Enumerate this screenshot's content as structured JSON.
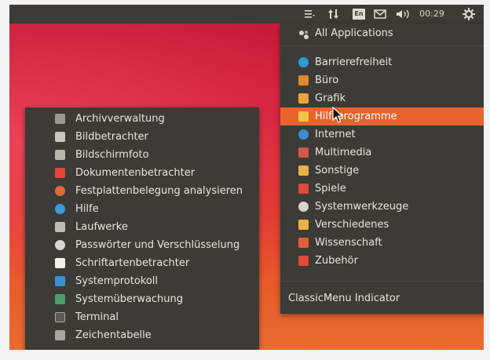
{
  "topbar": {
    "menu_icon": "menu-indicator-icon",
    "network_icon": "network-updown-icon",
    "keyboard_layout": "En",
    "mail_icon": "mail-icon",
    "volume_icon": "volume-icon",
    "clock": "00:29",
    "settings_icon": "gear-icon"
  },
  "main_menu": {
    "all_apps": "All Applications",
    "categories": [
      {
        "label": "Barrierefreiheit",
        "icon": "accessibility-icon",
        "color": "#2f98d8"
      },
      {
        "label": "Büro",
        "icon": "office-icon",
        "color": "#e0892e"
      },
      {
        "label": "Grafik",
        "icon": "graphics-icon",
        "color": "#f0a33a"
      },
      {
        "label": "Hilfsprogramme",
        "icon": "utilities-icon",
        "color": "#f2a53a",
        "active": true
      },
      {
        "label": "Internet",
        "icon": "internet-icon",
        "color": "#3b8ed6"
      },
      {
        "label": "Multimedia",
        "icon": "multimedia-icon",
        "color": "#d2584a"
      },
      {
        "label": "Sonstige",
        "icon": "other-icon",
        "color": "#e8b543"
      },
      {
        "label": "Spiele",
        "icon": "games-icon",
        "color": "#e04a3c"
      },
      {
        "label": "Systemwerkzeuge",
        "icon": "system-tools-icon",
        "color": "#d8d4cc"
      },
      {
        "label": "Verschiedenes",
        "icon": "misc-icon",
        "color": "#e8b543"
      },
      {
        "label": "Wissenschaft",
        "icon": "science-icon",
        "color": "#e25e3a"
      },
      {
        "label": "Zubehör",
        "icon": "accessories-icon",
        "color": "#e24a3a"
      }
    ],
    "classic_menu": "ClassicMenu Indicator"
  },
  "sub_menu": {
    "items": [
      {
        "label": "Archivverwaltung",
        "icon": "archive-manager-icon",
        "color": "#9a9a94"
      },
      {
        "label": "Bildbetrachter",
        "icon": "image-viewer-icon",
        "color": "#c9c6be"
      },
      {
        "label": "Bildschirmfoto",
        "icon": "screenshot-icon",
        "color": "#b8b5ad"
      },
      {
        "label": "Dokumentenbetrachter",
        "icon": "document-viewer-icon",
        "color": "#e2443a"
      },
      {
        "label": "Festplattenbelegung analysieren",
        "icon": "disk-usage-icon",
        "color": "#e26a3a"
      },
      {
        "label": "Hilfe",
        "icon": "help-icon",
        "color": "#3b9be0"
      },
      {
        "label": "Laufwerke",
        "icon": "disks-icon",
        "color": "#bfbcb4"
      },
      {
        "label": "Passwörter und Verschlüsselung",
        "icon": "keys-icon",
        "color": "#d9d6cf"
      },
      {
        "label": "Schriftartenbetrachter",
        "icon": "font-viewer-icon",
        "color": "#f0efe9"
      },
      {
        "label": "Systemprotokoll",
        "icon": "system-log-icon",
        "color": "#3d8fd3"
      },
      {
        "label": "Systemüberwachung",
        "icon": "system-monitor-icon",
        "color": "#4c9e6a"
      },
      {
        "label": "Terminal",
        "icon": "terminal-icon",
        "color": "#5b5a56"
      },
      {
        "label": "Zeichentabelle",
        "icon": "character-map-icon",
        "color": "#a9a6a0"
      }
    ]
  },
  "arrow": "›"
}
